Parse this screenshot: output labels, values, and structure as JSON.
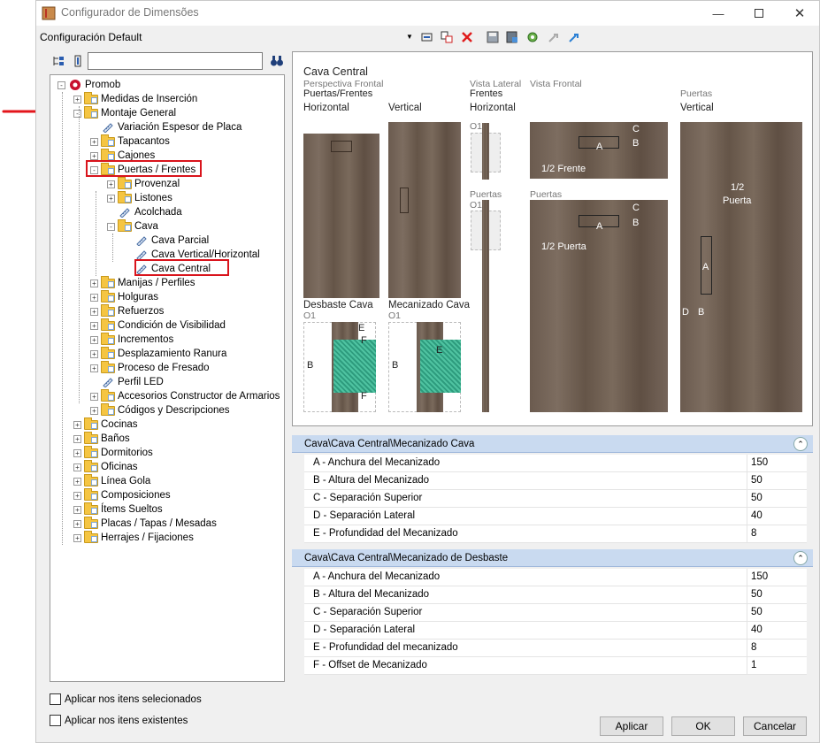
{
  "window": {
    "title": "Configurador de Dimensões"
  },
  "toolbar": {
    "config_value": "Configuración Default"
  },
  "tree": {
    "root": "Promob",
    "items": [
      {
        "label": "Medidas de Inserción",
        "level": 1,
        "exp": "+"
      },
      {
        "label": "Montaje General",
        "level": 1,
        "exp": "-"
      },
      {
        "label": "Variación Espesor de Placa",
        "level": 2,
        "exp": ""
      },
      {
        "label": "Tapacantos",
        "level": 2,
        "exp": "+"
      },
      {
        "label": "Cajones",
        "level": 2,
        "exp": "+"
      },
      {
        "label": "Puertas / Frentes",
        "level": 2,
        "exp": "-"
      },
      {
        "label": "Provenzal",
        "level": 3,
        "exp": "+"
      },
      {
        "label": "Listones",
        "level": 3,
        "exp": "+"
      },
      {
        "label": "Acolchada",
        "level": 3,
        "exp": ""
      },
      {
        "label": "Cava",
        "level": 3,
        "exp": "-"
      },
      {
        "label": "Cava Parcial",
        "level": 4,
        "exp": ""
      },
      {
        "label": "Cava Vertical/Horizontal",
        "level": 4,
        "exp": ""
      },
      {
        "label": "Cava Central",
        "level": 4,
        "exp": ""
      },
      {
        "label": "Manijas / Perfiles",
        "level": 2,
        "exp": "+"
      },
      {
        "label": "Holguras",
        "level": 2,
        "exp": "+"
      },
      {
        "label": "Refuerzos",
        "level": 2,
        "exp": "+"
      },
      {
        "label": "Condición de Visibilidad",
        "level": 2,
        "exp": "+"
      },
      {
        "label": "Incrementos",
        "level": 2,
        "exp": "+"
      },
      {
        "label": "Desplazamiento Ranura",
        "level": 2,
        "exp": "+"
      },
      {
        "label": "Proceso de Fresado",
        "level": 2,
        "exp": "+"
      },
      {
        "label": "Perfil LED",
        "level": 2,
        "exp": ""
      },
      {
        "label": "Accesorios Constructor de Armarios",
        "level": 2,
        "exp": "+"
      },
      {
        "label": "Códigos y Descripciones",
        "level": 2,
        "exp": "+"
      },
      {
        "label": "Cocinas",
        "level": 1,
        "exp": "+"
      },
      {
        "label": "Baños",
        "level": 1,
        "exp": "+"
      },
      {
        "label": "Dormitorios",
        "level": 1,
        "exp": "+"
      },
      {
        "label": "Oficinas",
        "level": 1,
        "exp": "+"
      },
      {
        "label": "Línea Gola",
        "level": 1,
        "exp": "+"
      },
      {
        "label": "Composiciones",
        "level": 1,
        "exp": "+"
      },
      {
        "label": "Ítems Sueltos",
        "level": 1,
        "exp": "+"
      },
      {
        "label": "Placas / Tapas / Mesadas",
        "level": 1,
        "exp": "+"
      },
      {
        "label": "Herrajes / Fijaciones",
        "level": 1,
        "exp": "+"
      }
    ]
  },
  "preview": {
    "title": "Cava Central",
    "sub1": "Perspectiva Frontal",
    "sub2": "Puertas/Frentes",
    "horizontal": "Horizontal",
    "vertical": "Vertical",
    "vista_lateral": "Vista Lateral",
    "frentes": "Frentes",
    "vista_lateral_h": "Horizontal",
    "vista_frontal": "Vista Frontal",
    "puertas_top": "Puertas",
    "puertas_vertical": "Vertical",
    "o1a": "O1",
    "puertas_lat": "Puertas",
    "o1b": "O1",
    "puertas_front": "Puertas",
    "half_frente": "1/2 Frente",
    "half_puerta": "1/2 Puerta",
    "half_puerta_v_1": "1/2",
    "half_puerta_v_2": "Puerta",
    "lbl_a": "A",
    "lbl_b": "B",
    "lbl_c": "C",
    "lbl_d": "D",
    "lbl_e": "E",
    "lbl_f": "F",
    "desbaste": "Desbaste Cava",
    "mecanizado": "Mecanizado Cava",
    "o1c": "O1",
    "o1d": "O1"
  },
  "sections": [
    {
      "title": "Cava\\Cava Central\\Mecanizado Cava",
      "rows": [
        {
          "name": "A - Anchura del Mecanizado",
          "value": "150"
        },
        {
          "name": "B - Altura del Mecanizado",
          "value": "50"
        },
        {
          "name": "C - Separación Superior",
          "value": "50"
        },
        {
          "name": "D - Separación Lateral",
          "value": "40"
        },
        {
          "name": "E - Profundidad del Mecanizado",
          "value": "8"
        }
      ]
    },
    {
      "title": "Cava\\Cava Central\\Mecanizado de Desbaste",
      "rows": [
        {
          "name": "A - Anchura del Mecanizado",
          "value": "150"
        },
        {
          "name": "B - Altura del Mecanizado",
          "value": "50"
        },
        {
          "name": "C - Separación Superior",
          "value": "50"
        },
        {
          "name": "D - Separación Lateral",
          "value": "40"
        },
        {
          "name": "E - Profundidad del mecanizado",
          "value": "8"
        },
        {
          "name": "F - Offset de Mecanizado",
          "value": "1"
        }
      ]
    }
  ],
  "checkboxes": {
    "selected": "Aplicar nos itens selecionados",
    "existing": "Aplicar nos itens existentes"
  },
  "buttons": {
    "apply": "Aplicar",
    "ok": "OK",
    "cancel": "Cancelar"
  }
}
